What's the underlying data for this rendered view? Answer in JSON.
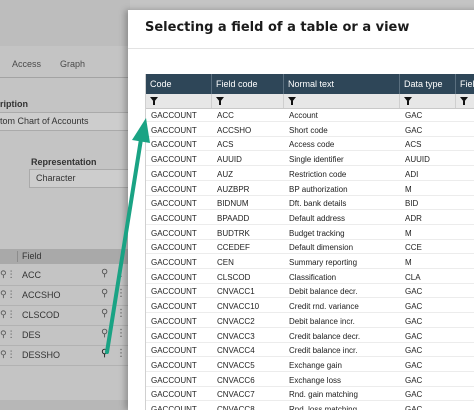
{
  "background": {
    "tabs": [
      "Access",
      "Graph"
    ],
    "description_label": "ription",
    "description_value": "tom Chart of Accounts",
    "representation_label": "Representation",
    "representation_value": "Character",
    "grid_header": "Field",
    "rows": [
      {
        "field": "ACC"
      },
      {
        "field": "ACCSHO"
      },
      {
        "field": "CLSCOD"
      },
      {
        "field": "DES"
      },
      {
        "field": "DESSHO"
      }
    ]
  },
  "modal": {
    "title": "Selecting a field of a table or a view",
    "columns": [
      "Code",
      "Field code",
      "Normal text",
      "Data type",
      "Field"
    ],
    "rows": [
      {
        "code": "GACCOUNT",
        "field_code": "ACC",
        "normal_text": "Account",
        "data_type": "GAC"
      },
      {
        "code": "GACCOUNT",
        "field_code": "ACCSHO",
        "normal_text": "Short code",
        "data_type": "GAC"
      },
      {
        "code": "GACCOUNT",
        "field_code": "ACS",
        "normal_text": "Access code",
        "data_type": "ACS"
      },
      {
        "code": "GACCOUNT",
        "field_code": "AUUID",
        "normal_text": "Single identifier",
        "data_type": "AUUID"
      },
      {
        "code": "GACCOUNT",
        "field_code": "AUZ",
        "normal_text": "Restriction code",
        "data_type": "ADI"
      },
      {
        "code": "GACCOUNT",
        "field_code": "AUZBPR",
        "normal_text": "BP authorization",
        "data_type": "M"
      },
      {
        "code": "GACCOUNT",
        "field_code": "BIDNUM",
        "normal_text": "Dft. bank details",
        "data_type": "BID"
      },
      {
        "code": "GACCOUNT",
        "field_code": "BPAADD",
        "normal_text": "Default address",
        "data_type": "ADR"
      },
      {
        "code": "GACCOUNT",
        "field_code": "BUDTRK",
        "normal_text": "Budget tracking",
        "data_type": "M"
      },
      {
        "code": "GACCOUNT",
        "field_code": "CCEDEF",
        "normal_text": "Default dimension",
        "data_type": "CCE"
      },
      {
        "code": "GACCOUNT",
        "field_code": "CEN",
        "normal_text": "Summary reporting",
        "data_type": "M"
      },
      {
        "code": "GACCOUNT",
        "field_code": "CLSCOD",
        "normal_text": "Classification",
        "data_type": "CLA"
      },
      {
        "code": "GACCOUNT",
        "field_code": "CNVACC1",
        "normal_text": "Debit balance decr.",
        "data_type": "GAC"
      },
      {
        "code": "GACCOUNT",
        "field_code": "CNVACC10",
        "normal_text": "Credit rnd. variance",
        "data_type": "GAC"
      },
      {
        "code": "GACCOUNT",
        "field_code": "CNVACC2",
        "normal_text": "Debit balance incr.",
        "data_type": "GAC"
      },
      {
        "code": "GACCOUNT",
        "field_code": "CNVACC3",
        "normal_text": "Credit balance decr.",
        "data_type": "GAC"
      },
      {
        "code": "GACCOUNT",
        "field_code": "CNVACC4",
        "normal_text": "Credit balance incr.",
        "data_type": "GAC"
      },
      {
        "code": "GACCOUNT",
        "field_code": "CNVACC5",
        "normal_text": "Exchange gain",
        "data_type": "GAC"
      },
      {
        "code": "GACCOUNT",
        "field_code": "CNVACC6",
        "normal_text": "Exchange loss",
        "data_type": "GAC"
      },
      {
        "code": "GACCOUNT",
        "field_code": "CNVACC7",
        "normal_text": "Rnd. gain matching",
        "data_type": "GAC"
      },
      {
        "code": "GACCOUNT",
        "field_code": "CNVACC8",
        "normal_text": "Rnd. loss matching",
        "data_type": "GAC"
      }
    ]
  },
  "colors": {
    "header_bg": "#2e4658",
    "arrow": "#1aa384"
  }
}
